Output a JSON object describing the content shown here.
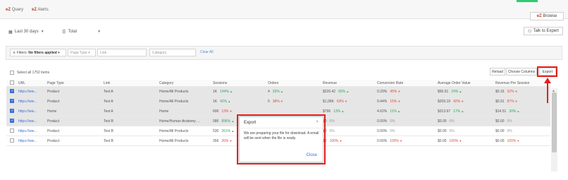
{
  "topnav": {
    "query_prefix": "eZ",
    "query_label": "Query",
    "alerts_prefix": "eZ",
    "alerts_label": "Alerts",
    "browse_prefix": "eZ",
    "browse_label": "Browse"
  },
  "toolbar": {
    "date_range": "Last 30 days",
    "view": "Total",
    "talk_label": "Talk to Expert"
  },
  "filters": {
    "filters_label": "Filters:",
    "filters_value": "No filters applied",
    "page_type_placeholder": "Page Type",
    "link_placeholder": "Link",
    "category_placeholder": "Category",
    "clear_all": "Clear All"
  },
  "selection": {
    "select_all": "Select all 1752 items"
  },
  "actions": {
    "reload": "Reload",
    "choose_columns": "Choose Columns",
    "export": "Export"
  },
  "columns": [
    "URL",
    "Page Type",
    "Link",
    "Category",
    "Sessions",
    "Orders",
    "Revenue",
    "Conversion Rate",
    "Average Order Value",
    "Revenue Per Session"
  ],
  "rows": [
    {
      "selected": true,
      "url": "https://ww...",
      "page_type": "Product",
      "link": "Test A",
      "category": "Home/All Products",
      "sessions": "1K",
      "sessions_chg": "144%",
      "sessions_dir": "up",
      "orders": "4",
      "orders_chg": "33%",
      "orders_dir": "up",
      "revenue": "$226.42",
      "revenue_chg": "65%",
      "revenue_dir": "up",
      "conv": "0.29%",
      "conv_chg": "45%",
      "conv_dir": "down",
      "aov": "$56.61",
      "aov_chg": "24%",
      "aov_dir": "up",
      "rps": "$0.16",
      "rps_chg": "32%",
      "rps_dir": "down"
    },
    {
      "selected": true,
      "url": "https://ww...",
      "page_type": "Product",
      "link": "Test A",
      "category": "Home/All Products",
      "sessions": "1K",
      "sessions_chg": "42%",
      "sessions_dir": "up",
      "orders": "5",
      "orders_chg": "38%",
      "orders_dir": "down",
      "revenue": "$1,05K",
      "revenue_chg": "63%",
      "revenue_dir": "down",
      "conv": "0.44%",
      "conv_chg": "15%",
      "conv_dir": "down",
      "aov": "$209.19",
      "aov_chg": "42%",
      "aov_dir": "down",
      "rps": "$0.91",
      "rps_chg": "87%",
      "rps_dir": "down"
    },
    {
      "selected": true,
      "url": "https://ww...",
      "page_type": "Home",
      "link": "Test A",
      "category": "Home",
      "sessions": "606",
      "sessions_chg": "13%",
      "sessions_dir": "down",
      "orders": "",
      "orders_chg": "",
      "orders_dir": "neutral",
      "revenue": "$796",
      "revenue_chg": "13%",
      "revenue_dir": "up",
      "conv": "4.62%",
      "conv_chg": "11%",
      "conv_dir": "up",
      "aov": "$313.97",
      "aov_chg": "17%",
      "aov_dir": "up",
      "rps": "$14.51",
      "rps_chg": "30%",
      "rps_dir": "up"
    },
    {
      "selected": true,
      "url": "https://ww...",
      "page_type": "Product",
      "link": "Test B",
      "category": "Home/Human Anatomy ...",
      "sessions": "586",
      "sessions_chg": "896%",
      "sessions_dir": "up",
      "orders": "",
      "orders_chg": "",
      "orders_dir": "neutral",
      "revenue": "$0",
      "revenue_chg": "0%",
      "revenue_dir": "neutral",
      "conv": "0.00%",
      "conv_chg": "0%",
      "conv_dir": "neutral",
      "aov": "$0.00",
      "aov_chg": "0%",
      "aov_dir": "neutral",
      "rps": "$0.00",
      "rps_chg": "0%",
      "rps_dir": "neutral"
    },
    {
      "selected": false,
      "url": "https://ww...",
      "page_type": "Product",
      "link": "Test B",
      "category": "Home/All Products",
      "sessions": "530",
      "sessions_chg": "261%",
      "sessions_dir": "up",
      "orders": "",
      "orders_chg": "",
      "orders_dir": "neutral",
      "revenue": "$0",
      "revenue_chg": "0%",
      "revenue_dir": "neutral",
      "conv": "0.00%",
      "conv_chg": "0%",
      "conv_dir": "neutral",
      "aov": "$0.00",
      "aov_chg": "0%",
      "aov_dir": "neutral",
      "rps": "$0.00",
      "rps_chg": "0%",
      "rps_dir": "neutral"
    },
    {
      "selected": false,
      "url": "https://ww...",
      "page_type": "Product",
      "link": "Test B",
      "category": "Home/All Products",
      "sessions": "356",
      "sessions_chg": "26%",
      "sessions_dir": "down",
      "orders": "0",
      "orders_chg": "100%",
      "orders_dir": "down",
      "revenue": "$0",
      "revenue_chg": "100%",
      "revenue_dir": "down",
      "conv": "0.00%",
      "conv_chg": "100%",
      "conv_dir": "down",
      "aov": "$0.00",
      "aov_chg": "100%",
      "aov_dir": "down",
      "rps": "$0.00",
      "rps_chg": "100%",
      "rps_dir": "down"
    }
  ],
  "modal": {
    "title": "Export",
    "close_symbol": "×",
    "message": "We are preparing your file for download. A email will be sent when the file is ready.",
    "close_button": "Close"
  },
  "colors": {
    "brand": "#c0392b",
    "checkbox": "#3b6fd8",
    "up": "#27ae60",
    "down": "#e74c3c",
    "annotation": "#e02020"
  }
}
